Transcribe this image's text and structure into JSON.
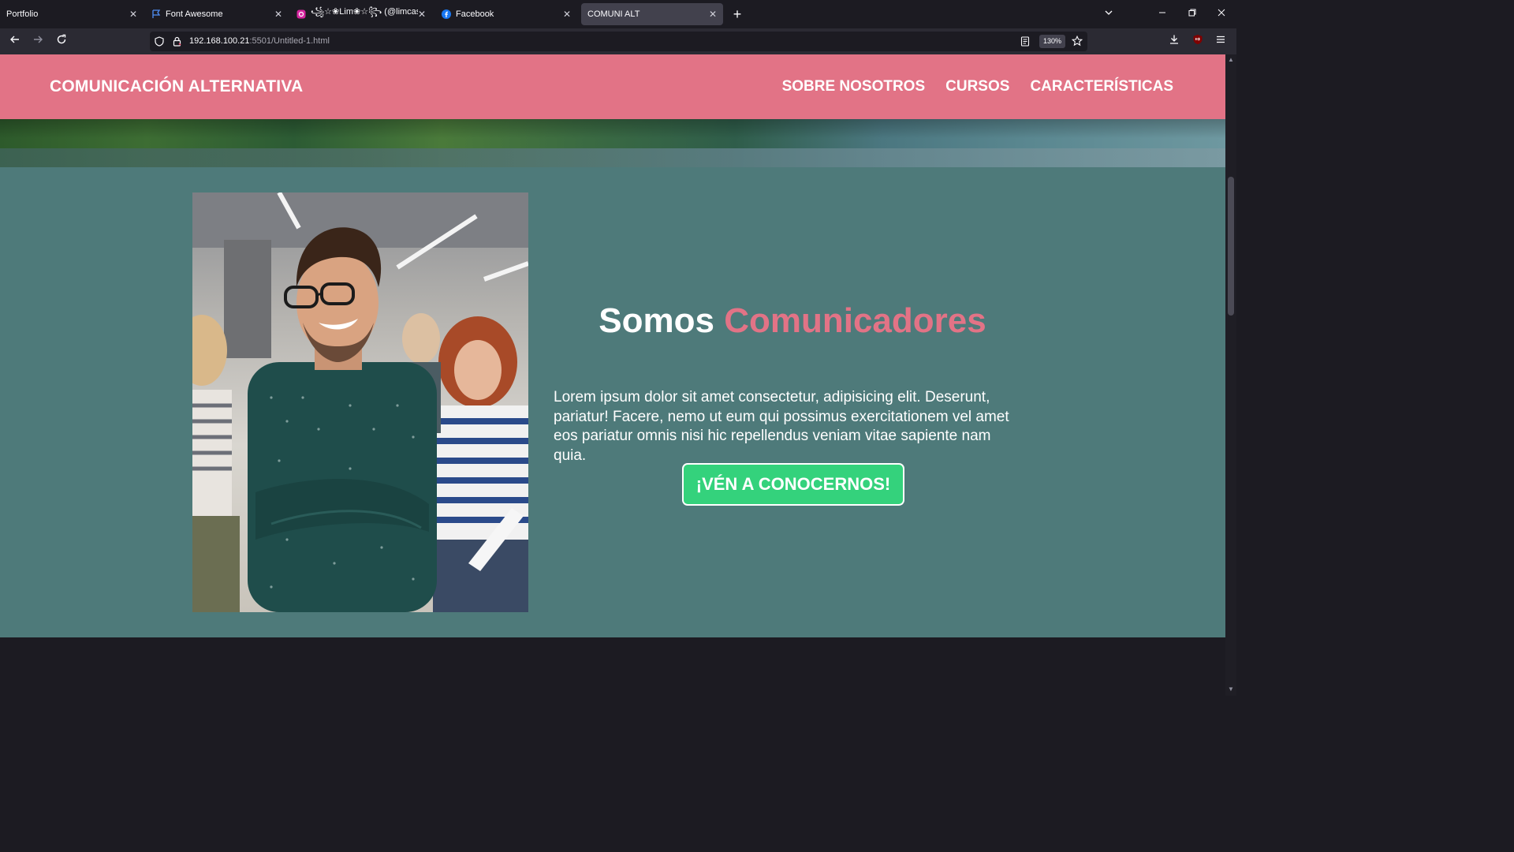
{
  "browser": {
    "tabs": [
      {
        "title": "Portfolio",
        "icon": "none",
        "active": false
      },
      {
        "title": "Font Awesome",
        "icon": "flag-icon",
        "active": false
      },
      {
        "title": "꧁☆❀Lim❀☆꧂ (@limcast_)",
        "icon": "instagram-icon",
        "active": false
      },
      {
        "title": "Facebook",
        "icon": "facebook-icon",
        "active": false
      },
      {
        "title": "COMUNI ALT",
        "icon": "none",
        "active": true
      }
    ],
    "close_glyph": "✕",
    "new_tab": "+",
    "url_host": "192.168.100.21",
    "url_rest": ":5501/Untitled-1.html",
    "zoom": "130%"
  },
  "site": {
    "logo": "COMUNICACIÓN ALTERNATIVA",
    "nav": [
      "SOBRE NOSOTROS",
      "CURSOS",
      "CARACTERÍSTICAS"
    ],
    "hero": {
      "title_plain": "Somos",
      "title_accent": "Comunicadores",
      "text": "Lorem ipsum dolor sit amet consectetur, adipisicing elit. Deserunt, pariatur! Facere, nemo ut eum qui possimus exercitationem vel amet eos pariatur omnis nisi hic repellendus veniam vitae sapiente nam quia.",
      "cta": "¡VÉN A CONOCERNOS!"
    }
  },
  "colors": {
    "header_pink": "#e27386",
    "hero_teal": "#4e7a7a",
    "cta_green": "#34d27c",
    "browser_dark": "#1c1b22"
  }
}
